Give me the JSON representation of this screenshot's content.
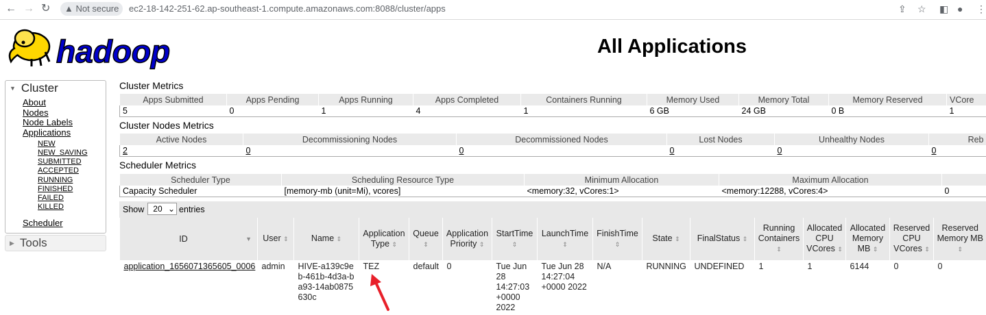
{
  "browser": {
    "security_label": "Not secure",
    "url": "ec2-18-142-251-62.ap-southeast-1.compute.amazonaws.com:8088/cluster/apps"
  },
  "brand": {
    "logo_text": "hadoop",
    "logo_color": "#0000cc",
    "elephant_color": "#ffd700"
  },
  "page_title": "All Applications",
  "sidebar": {
    "cluster_label": "Cluster",
    "items": [
      "About",
      "Nodes",
      "Node Labels",
      "Applications"
    ],
    "app_states": [
      "NEW",
      "NEW_SAVING",
      "SUBMITTED",
      "ACCEPTED",
      "RUNNING",
      "FINISHED",
      "FAILED",
      "KILLED"
    ],
    "scheduler_label": "Scheduler",
    "tools_label": "Tools"
  },
  "cluster_metrics": {
    "title": "Cluster Metrics",
    "headers": [
      "Apps Submitted",
      "Apps Pending",
      "Apps Running",
      "Apps Completed",
      "Containers Running",
      "Memory Used",
      "Memory Total",
      "Memory Reserved",
      "VCore"
    ],
    "values": [
      "5",
      "0",
      "1",
      "4",
      "1",
      "6 GB",
      "24 GB",
      "0 B",
      "1"
    ]
  },
  "nodes_metrics": {
    "title": "Cluster Nodes Metrics",
    "headers": [
      "Active Nodes",
      "Decommissioning Nodes",
      "Decommissioned Nodes",
      "Lost Nodes",
      "Unhealthy Nodes",
      "Reb"
    ],
    "values": [
      "2",
      "0",
      "0",
      "0",
      "0",
      "0"
    ]
  },
  "scheduler_metrics": {
    "title": "Scheduler Metrics",
    "headers": [
      "Scheduler Type",
      "Scheduling Resource Type",
      "Minimum Allocation",
      "Maximum Allocation",
      ""
    ],
    "values": [
      "Capacity Scheduler",
      "[memory-mb (unit=Mi), vcores]",
      "<memory:32, vCores:1>",
      "<memory:12288, vCores:4>",
      "0"
    ]
  },
  "entries": {
    "show_label": "Show",
    "page_size": "20",
    "entries_label": "entries"
  },
  "apps_table": {
    "headers": {
      "id": "ID",
      "user": "User",
      "name": "Name",
      "app_type": "Application Type",
      "queue": "Queue",
      "priority": "Application Priority",
      "start": "StartTime",
      "launch": "LaunchTime",
      "finish": "FinishTime",
      "state": "State",
      "final": "FinalStatus",
      "running": "Running Containers",
      "alloc_cpu": "Allocated CPU VCores",
      "alloc_mem": "Allocated Memory MB",
      "res_cpu": "Reserved CPU VCores",
      "res_mem": "Reserved Memory MB"
    },
    "row": {
      "id": "application_1656071365605_0006",
      "user": "admin",
      "name": "HIVE-a139c9eb-461b-4d3a-ba93-14ab0875630c",
      "app_type": "TEZ",
      "queue": "default",
      "priority": "0",
      "start": "Tue Jun 28 14:27:03 +0000 2022",
      "launch": "Tue Jun 28 14:27:04 +0000 2022",
      "finish": "N/A",
      "state": "RUNNING",
      "final": "UNDEFINED",
      "running": "1",
      "alloc_cpu": "1",
      "alloc_mem": "6144",
      "res_cpu": "0",
      "res_mem": "0"
    }
  },
  "annotation": {
    "arrow_color": "#e8202a"
  }
}
